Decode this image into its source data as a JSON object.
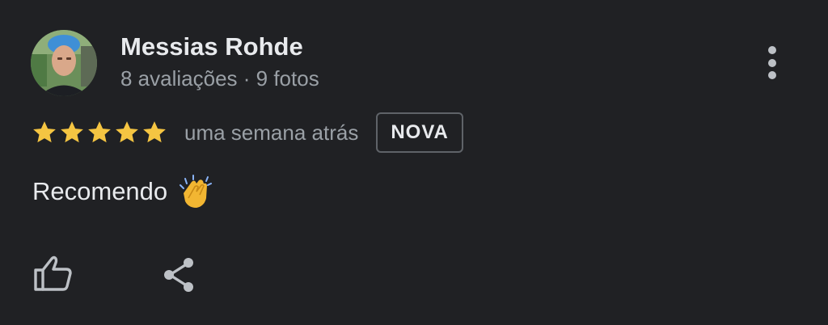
{
  "review": {
    "author": {
      "name": "Messias Rohde",
      "meta": "8 avaliações · 9 fotos",
      "avatar_icon": "user-avatar-photo"
    },
    "rating": 5,
    "rating_max": 5,
    "time": "uma semana atrás",
    "badge": "NOVA",
    "text": "Recomendo",
    "emoji_icon": "clapping-hands-emoji"
  },
  "actions": {
    "more_icon": "more-vert-icon",
    "like_icon": "thumbs-up-icon",
    "share_icon": "share-icon"
  },
  "colors": {
    "background": "#202124",
    "primary_text": "#e8eaed",
    "secondary_text": "#9aa0a6",
    "star": "#f5c542",
    "badge_border": "#5f6368"
  }
}
